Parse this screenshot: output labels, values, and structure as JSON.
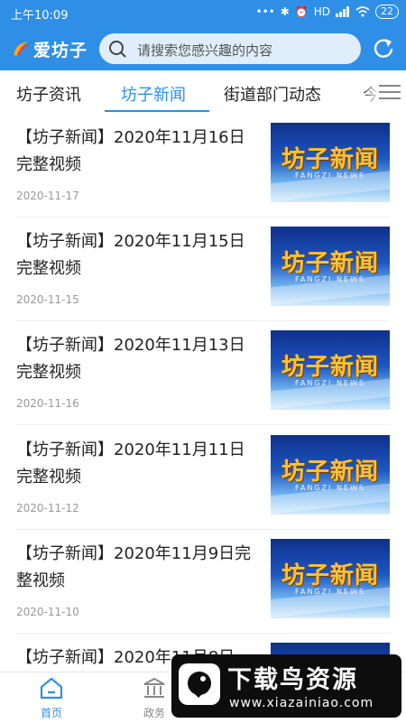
{
  "status": {
    "time": "上午10:09",
    "network": "HD",
    "battery": "22"
  },
  "header": {
    "app_name": "爱坊子",
    "search_placeholder": "请搜索您感兴趣的内容"
  },
  "tabs": [
    {
      "label": "坊子资讯",
      "active": false
    },
    {
      "label": "坊子新闻",
      "active": true
    },
    {
      "label": "街道部门动态",
      "active": false
    },
    {
      "label": "今",
      "active": false
    }
  ],
  "thumbnail": {
    "logo_text": "坊子新闻",
    "logo_sub": "FANGZI NEWS"
  },
  "news": [
    {
      "title": "【坊子新闻】2020年11月16日完整视频",
      "date": "2020-11-17"
    },
    {
      "title": "【坊子新闻】2020年11月15日完整视频",
      "date": "2020-11-15"
    },
    {
      "title": "【坊子新闻】2020年11月13日完整视频",
      "date": "2020-11-16"
    },
    {
      "title": "【坊子新闻】2020年11月11日完整视频",
      "date": "2020-11-12"
    },
    {
      "title": "【坊子新闻】2020年11月9日完整视频",
      "date": "2020-11-10"
    },
    {
      "title": "【坊子新闻】2020年11月8日",
      "date": ""
    }
  ],
  "bottom_nav": [
    {
      "label": "首页",
      "active": true
    },
    {
      "label": "政务",
      "active": false
    }
  ],
  "watermark": {
    "title": "下载鸟资源",
    "url": "www.xiazainiao.com"
  },
  "colors": {
    "primary": "#2f8fe6",
    "search_bg": "#dfeefa",
    "date": "#999999"
  }
}
